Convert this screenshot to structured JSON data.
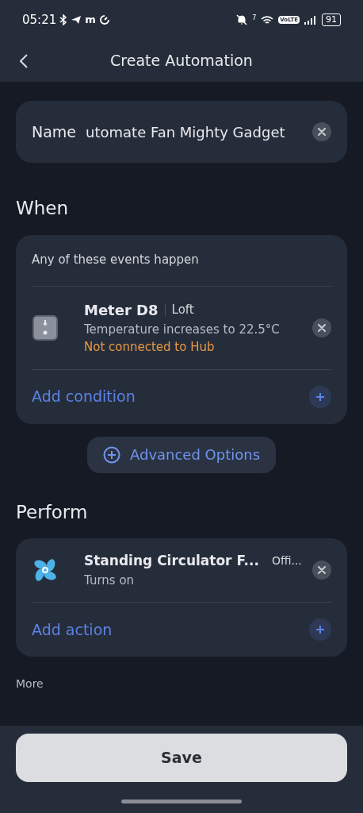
{
  "status_bar": {
    "time": "05:21",
    "app_letter": "m",
    "wifi_label": "7",
    "network_badge": "VoLTE",
    "battery": "91"
  },
  "header": {
    "title": "Create Automation"
  },
  "name_field": {
    "label": "Name",
    "value": "utomate Fan Mighty Gadget"
  },
  "when": {
    "heading": "When",
    "subtitle": "Any of these events happen",
    "conditions": [
      {
        "kind": "meter",
        "device": "Meter D8",
        "room": "Loft",
        "description": "Temperature increases to 22.5°C",
        "warning": "Not connected to Hub"
      }
    ],
    "add_label": "Add condition"
  },
  "advanced_options": "Advanced Options",
  "perform": {
    "heading": "Perform",
    "actions": [
      {
        "kind": "fan",
        "device": "Standing Circulator F...",
        "room": "Offi...",
        "description": "Turns on"
      }
    ],
    "add_label": "Add action"
  },
  "more_heading": "More",
  "save_button": "Save"
}
